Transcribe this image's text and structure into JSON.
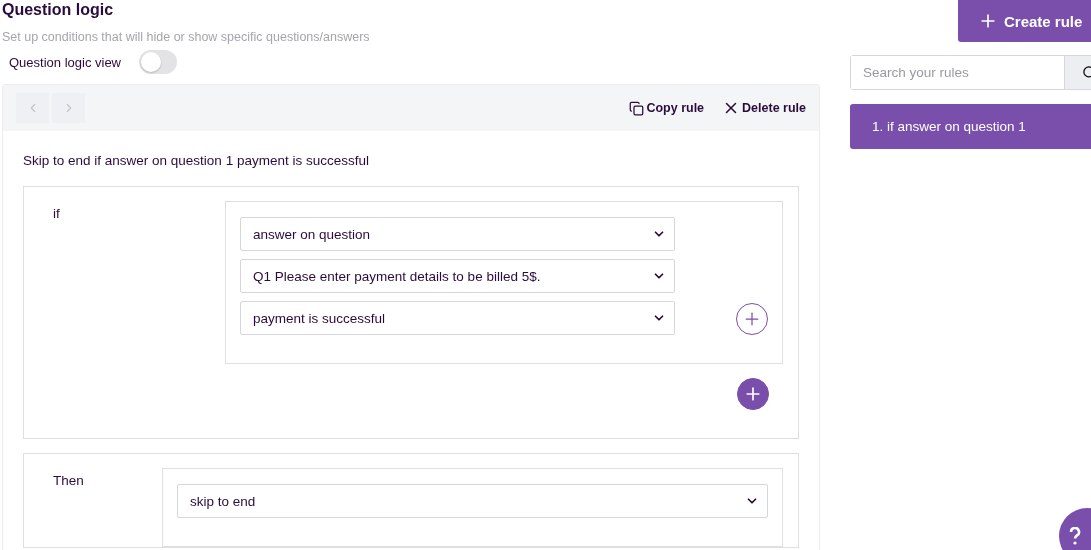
{
  "header": {
    "title": "Question logic",
    "subtitle": "Set up conditions that will hide or show specific questions/answers",
    "toggle": {
      "label": "Question logic view",
      "on": false
    }
  },
  "create_button": {
    "label": "Create rule"
  },
  "search": {
    "placeholder": "Search your rules"
  },
  "rules": [
    {
      "label": "1. if answer on question 1",
      "selected": true
    }
  ],
  "editor": {
    "nav": [
      {
        "kind": "prev",
        "disabled": true
      },
      {
        "kind": "next",
        "disabled": true
      }
    ],
    "actions": [
      {
        "kind": "copy",
        "label": "Copy rule"
      },
      {
        "kind": "delete",
        "label": "Delete rule"
      }
    ],
    "summary": "Skip to end if answer on question 1 payment is successful",
    "condition": {
      "label": "if",
      "selects": [
        "answer on question",
        "Q1 Please enter payment details to be billed 5$.",
        "payment is successful"
      ]
    },
    "action": {
      "label": "Then",
      "selects": [
        "skip to end"
      ]
    }
  }
}
